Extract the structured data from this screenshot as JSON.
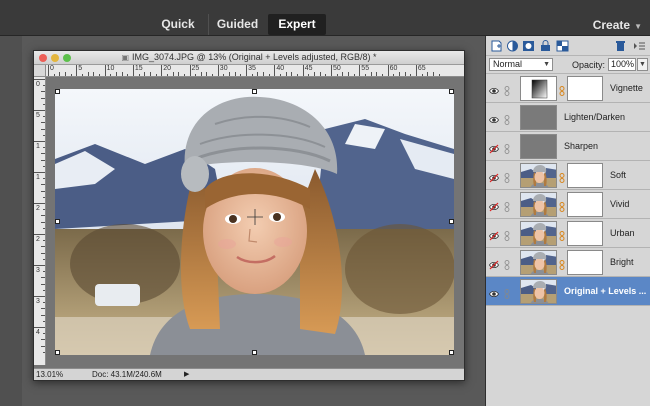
{
  "modes": {
    "quick": "Quick",
    "guided": "Guided",
    "expert": "Expert",
    "active": "expert"
  },
  "create_label": "Create",
  "document": {
    "title": "IMG_3074.JPG @ 13% (Original + Levels adjusted, RGB/8) *",
    "zoom": "13.01%",
    "doc_size": "Doc: 43.1M/240.6M",
    "ruler_top": [
      "0",
      "5",
      "10",
      "15",
      "20",
      "25",
      "30",
      "35",
      "40",
      "45",
      "50",
      "55",
      "60",
      "65"
    ],
    "ruler_left": [
      "0",
      "5",
      "1",
      "1",
      "2",
      "2",
      "3",
      "3",
      "4"
    ]
  },
  "panel": {
    "blend_mode": "Normal",
    "opacity_label": "Opacity:",
    "opacity_value": "100%",
    "layers": [
      {
        "name": "Vignette",
        "visible": true,
        "thumb": "gradient",
        "mask": true,
        "selected": false
      },
      {
        "name": "Lighten/Darken",
        "visible": true,
        "thumb": "grey",
        "mask": false,
        "selected": false
      },
      {
        "name": "Sharpen",
        "visible": false,
        "thumb": "grey",
        "mask": false,
        "selected": false
      },
      {
        "name": "Soft",
        "visible": false,
        "thumb": "photo",
        "mask": true,
        "selected": false
      },
      {
        "name": "Vivid",
        "visible": false,
        "thumb": "photo",
        "mask": true,
        "selected": false
      },
      {
        "name": "Urban",
        "visible": false,
        "thumb": "photo",
        "mask": true,
        "selected": false
      },
      {
        "name": "Bright",
        "visible": false,
        "thumb": "photo",
        "mask": true,
        "selected": false
      },
      {
        "name": "Original + Levels ...",
        "visible": true,
        "thumb": "photo",
        "mask": false,
        "selected": true
      }
    ]
  },
  "colors": {
    "selected_layer": "#5b87c6",
    "app_background": "#595959"
  }
}
